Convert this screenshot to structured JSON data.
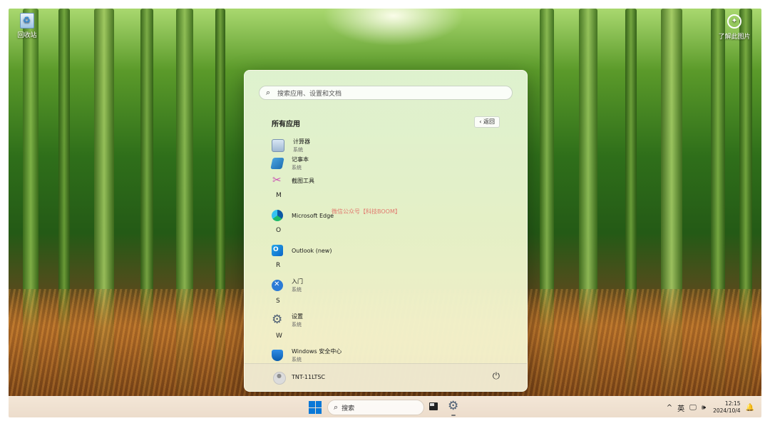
{
  "desktop": {
    "recycle_bin_label": "回收站",
    "learn_picture_label": "了解此图片"
  },
  "start_menu": {
    "search_placeholder": "搜索应用、设置和文档",
    "all_apps_title": "所有应用",
    "back_label": "返回",
    "apps": [
      {
        "name": "计算器",
        "subtitle": "系统",
        "icon": "calculator-icon"
      },
      {
        "name": "记事本",
        "subtitle": "系统",
        "icon": "notepad-icon"
      },
      {
        "name": "截图工具",
        "subtitle": "",
        "icon": "snipping-tool-icon"
      },
      {
        "letter": "M"
      },
      {
        "name": "Microsoft Edge",
        "subtitle": "",
        "icon": "edge-icon"
      },
      {
        "letter": "O"
      },
      {
        "name": "Outlook (new)",
        "subtitle": "",
        "icon": "outlook-icon"
      },
      {
        "letter": "R"
      },
      {
        "name": "入门",
        "subtitle": "系统",
        "icon": "get-started-icon"
      },
      {
        "letter": "S"
      },
      {
        "name": "设置",
        "subtitle": "系统",
        "icon": "settings-icon"
      },
      {
        "letter": "W"
      },
      {
        "name": "Windows 安全中心",
        "subtitle": "系统",
        "icon": "security-shield-icon"
      }
    ],
    "watermark": "微信公众号【科技BOOM】",
    "user_name": "TNT-11LTSC"
  },
  "taskbar": {
    "search_label": "搜索",
    "ime_label": "英",
    "time": "12:15",
    "date": "2024/10/4"
  }
}
